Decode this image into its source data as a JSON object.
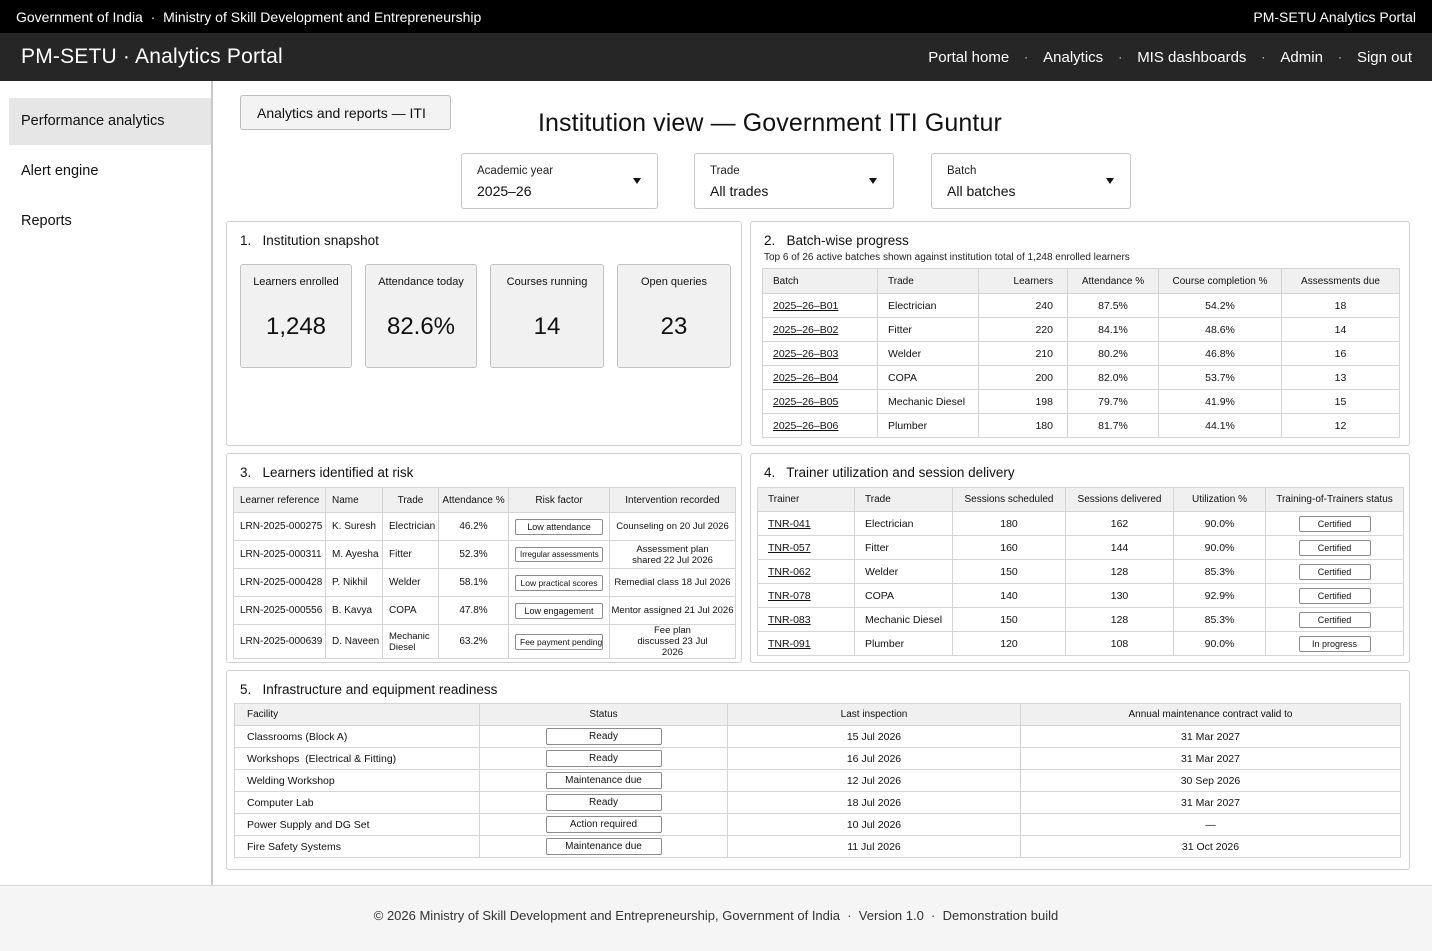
{
  "gov_bar": {
    "left": "Government of India  ·  Ministry of Skill Development and Entrepreneurship",
    "right": "PM-SETU Analytics Portal"
  },
  "app_bar": {
    "title": "PM-SETU · Analytics Portal",
    "nav": [
      "Portal home",
      "Analytics",
      "MIS dashboards",
      "Admin",
      "Sign out"
    ],
    "separator": "·"
  },
  "sidebar": {
    "items": [
      "Performance analytics",
      "Alert engine",
      "Reports"
    ],
    "active_index": 0
  },
  "breadcrumb": "Analytics and reports — ITI",
  "page_title": "Institution view — Government ITI Guntur",
  "filters": [
    {
      "label": "Academic year",
      "value": "2025–26"
    },
    {
      "label": "Trade",
      "value": "All trades"
    },
    {
      "label": "Batch",
      "value": "All batches"
    }
  ],
  "snapshot": {
    "title": "1.   Institution snapshot",
    "kpis": [
      {
        "label": "Learners enrolled",
        "value": "1,248"
      },
      {
        "label": "Attendance today",
        "value": "82.6%"
      },
      {
        "label": "Courses running",
        "value": "14"
      },
      {
        "label": "Open queries",
        "value": "23"
      }
    ]
  },
  "batch_progress": {
    "title": "2.   Batch-wise progress",
    "subtitle": "Top 6 of 26 active batches shown against institution total of 1,248 enrolled learners",
    "columns": [
      "Batch",
      "Trade",
      "Learners",
      "Attendance %",
      "Course completion %",
      "Assessments due"
    ],
    "rows": [
      [
        "2025–26–B01",
        "Electrician",
        "240",
        "87.5%",
        "54.2%",
        "18"
      ],
      [
        "2025–26–B02",
        "Fitter",
        "220",
        "84.1%",
        "48.6%",
        "14"
      ],
      [
        "2025–26–B03",
        "Welder",
        "210",
        "80.2%",
        "46.8%",
        "16"
      ],
      [
        "2025–26–B04",
        "COPA",
        "200",
        "82.0%",
        "53.7%",
        "13"
      ],
      [
        "2025–26–B05",
        "Mechanic Diesel",
        "198",
        "79.7%",
        "41.9%",
        "15"
      ],
      [
        "2025–26–B06",
        "Plumber",
        "180",
        "81.7%",
        "44.1%",
        "12"
      ]
    ]
  },
  "at_risk": {
    "title": "3.   Learners identified at risk",
    "columns": [
      "Learner reference",
      "Name",
      "Trade",
      "Attendance %",
      "Risk factor",
      "Intervention recorded"
    ],
    "rows": [
      [
        "LRN-2025-000275",
        "K. Suresh",
        "Electrician",
        "46.2%",
        "Low attendance",
        "Counseling on 20 Jul 2026"
      ],
      [
        "LRN-2025-000311",
        "M. Ayesha",
        "Fitter",
        "52.3%",
        "Irregular assessments",
        "Assessment plan shared 22 Jul 2026"
      ],
      [
        "LRN-2025-000428",
        "P. Nikhil",
        "Welder",
        "58.1%",
        "Low practical scores",
        "Remedial class 18 Jul 2026"
      ],
      [
        "LRN-2025-000556",
        "B. Kavya",
        "COPA",
        "47.8%",
        "Low engagement",
        "Mentor assigned 21 Jul 2026"
      ],
      [
        "LRN-2025-000639",
        "D. Naveen",
        "Mechanic Diesel",
        "63.2%",
        "Fee payment pending",
        "Fee plan discussed 23 Jul 2026"
      ]
    ]
  },
  "trainers": {
    "title": "4.   Trainer utilization and session delivery",
    "columns": [
      "Trainer",
      "Trade",
      "Sessions scheduled",
      "Sessions delivered",
      "Utilization %",
      "Training-of-Trainers status"
    ],
    "rows": [
      [
        "TNR-041",
        "Electrician",
        "180",
        "162",
        "90.0%",
        "Certified"
      ],
      [
        "TNR-057",
        "Fitter",
        "160",
        "144",
        "90.0%",
        "Certified"
      ],
      [
        "TNR-062",
        "Welder",
        "150",
        "128",
        "85.3%",
        "Certified"
      ],
      [
        "TNR-078",
        "COPA",
        "140",
        "130",
        "92.9%",
        "Certified"
      ],
      [
        "TNR-083",
        "Mechanic Diesel",
        "150",
        "128",
        "85.3%",
        "Certified"
      ],
      [
        "TNR-091",
        "Plumber",
        "120",
        "108",
        "90.0%",
        "In progress"
      ]
    ]
  },
  "infrastructure": {
    "title": "5.   Infrastructure and equipment readiness",
    "columns": [
      "Facility",
      "Status",
      "Last inspection",
      "Annual maintenance contract valid to"
    ],
    "rows": [
      [
        "Classrooms (Block A)",
        "Ready",
        "15 Jul 2026",
        "31 Mar 2027"
      ],
      [
        "Workshops  (Electrical & Fitting)",
        "Ready",
        "16 Jul 2026",
        "31 Mar 2027"
      ],
      [
        "Welding Workshop",
        "Maintenance due",
        "12 Jul 2026",
        "30 Sep 2026"
      ],
      [
        "Computer Lab",
        "Ready",
        "18 Jul 2026",
        "31 Mar 2027"
      ],
      [
        "Power Supply and DG Set",
        "Action required",
        "10 Jul 2026",
        "—"
      ],
      [
        "Fire Safety Systems",
        "Maintenance due",
        "11 Jul 2026",
        "31 Oct 2026"
      ]
    ]
  },
  "footer": "© 2026 Ministry of Skill Development and Entrepreneurship, Government of India  ·  Version 1.0  ·  Demonstration build"
}
